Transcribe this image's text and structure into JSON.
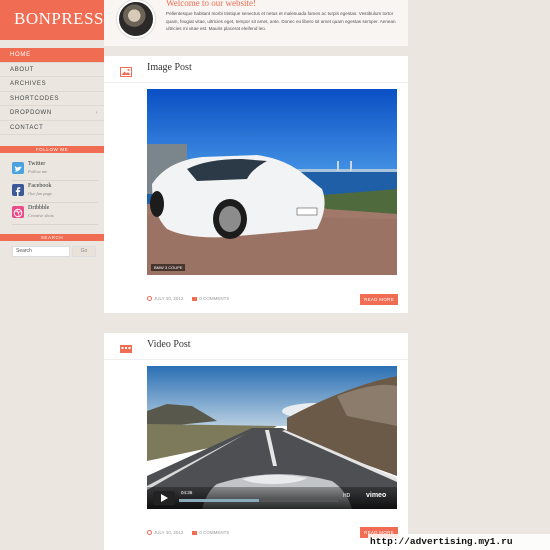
{
  "site": {
    "logo": "BONPRESS"
  },
  "nav": {
    "items": [
      {
        "label": "HOME",
        "active": true,
        "has_arrow": false
      },
      {
        "label": "ABOUT",
        "active": false,
        "has_arrow": false
      },
      {
        "label": "ARCHIVES",
        "active": false,
        "has_arrow": false
      },
      {
        "label": "SHORTCODES",
        "active": false,
        "has_arrow": false
      },
      {
        "label": "DROPDOWN",
        "active": false,
        "has_arrow": true
      },
      {
        "label": "CONTACT",
        "active": false,
        "has_arrow": false
      }
    ]
  },
  "follow": {
    "heading": "FOLLOW ME",
    "items": [
      {
        "name": "Twitter",
        "sub": "Follow me",
        "icon": "twitter-icon",
        "color": "#4aa3df"
      },
      {
        "name": "Facebook",
        "sub": "Our fan page",
        "icon": "facebook-icon",
        "color": "#3b5998"
      },
      {
        "name": "Dribbble",
        "sub": "Creative shots",
        "icon": "dribbble-icon",
        "color": "#ea4c89"
      }
    ]
  },
  "search": {
    "heading": "SEARCH",
    "placeholder": "Search",
    "button": "Go"
  },
  "welcome": {
    "title": "Welcome to our website!",
    "text": "Pellentesque habitant morbi tristique senectus et netus et malesuada fames ac turpis egestas. Vestibulum tortor quam, feugiat vitae, ultricies eget, tempor sit amet, ante. Donec eu libero sit amet quam egestas semper. Aenean ultricies mi vitae est. Mauris placerat eleifend leo."
  },
  "posts": [
    {
      "title": "Image Post",
      "icon": "image-icon",
      "caption": "BMW 3 COUPE",
      "date": "JULY 30, 2012",
      "comments": "0 COMMENTS",
      "read_more": "READ MORE"
    },
    {
      "title": "Video Post",
      "icon": "video-icon",
      "time": "04:36",
      "hd": "HD",
      "brand": "vimeo",
      "progress": 0.5,
      "date": "JULY 30, 2012",
      "comments": "0 COMMENTS",
      "read_more": "READ MORE"
    }
  ],
  "accent_color": "#f06c52",
  "watermark": "http://advertising.my1.ru"
}
